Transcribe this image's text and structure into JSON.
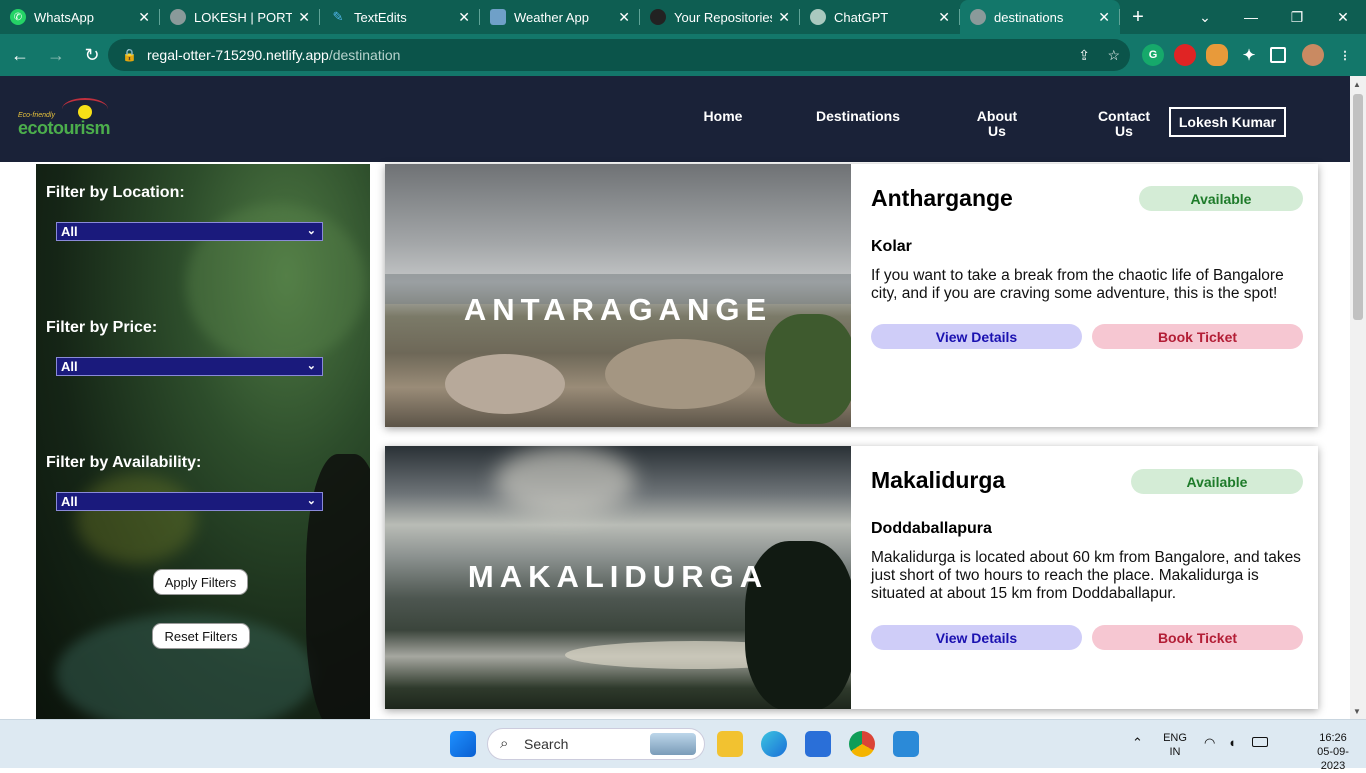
{
  "browser": {
    "tabs": [
      {
        "label": "WhatsApp",
        "icon": "whatsapp-icon",
        "color": "#25d366"
      },
      {
        "label": "LOKESH | PORTFO",
        "icon": "globe-icon",
        "color": "#8a9a9a"
      },
      {
        "label": "TextEdits",
        "icon": "pen-icon",
        "color": "#4fb5e8"
      },
      {
        "label": "Weather App",
        "icon": "weather-icon",
        "color": "#6fa0c8"
      },
      {
        "label": "Your Repositories",
        "icon": "github-icon",
        "color": "#222222"
      },
      {
        "label": "ChatGPT",
        "icon": "chatgpt-icon",
        "color": "#a9c9bf"
      },
      {
        "label": "destinations",
        "icon": "globe-icon",
        "color": "#8a9a9a"
      }
    ],
    "url_host": "regal-otter-715290.netlify.app",
    "url_path": "/destination"
  },
  "site": {
    "logo_tagline": "Eco-friendly",
    "logo_word": "ecotourism",
    "nav": [
      {
        "label": "Home"
      },
      {
        "label": "Destinations"
      },
      {
        "label": "About Us"
      },
      {
        "label": "Contact Us"
      }
    ],
    "user": "Lokesh Kumar"
  },
  "filters": {
    "location_label": "Filter by Location:",
    "location_value": "All",
    "price_label": "Filter by Price:",
    "price_value": "All",
    "availability_label": "Filter by Availability:",
    "availability_value": "All",
    "apply_label": "Apply Filters",
    "reset_label": "Reset Filters"
  },
  "destinations": [
    {
      "image_caption": "ANTARAGANGE",
      "title": "Anthargange",
      "status": "Available",
      "location": "Kolar",
      "description": "If you want to take a break from the chaotic life of Bangalore city, and if you are craving some adventure, this is the spot!",
      "view_label": "View Details",
      "book_label": "Book Ticket"
    },
    {
      "image_caption": "MAKALIDURGA",
      "title": "Makalidurga",
      "status": "Available",
      "location": "Doddaballapura",
      "description": "Makalidurga is located about 60 km from Bangalore, and takes just short of two hours to reach the place. Makalidurga is situated at about 15 km from Doddaballapur.",
      "view_label": "View Details",
      "book_label": "Book Ticket"
    }
  ],
  "taskbar": {
    "search_placeholder": "Search",
    "lang": "ENG",
    "region": "IN",
    "time": "16:26",
    "date": "05-09-2023"
  },
  "colors": {
    "header_bg": "#1a2238",
    "chrome_bg": "#13776a",
    "available_bg": "#d4ecd6",
    "view_btn_bg": "#cfcdf8",
    "book_btn_bg": "#f6c7d2"
  }
}
